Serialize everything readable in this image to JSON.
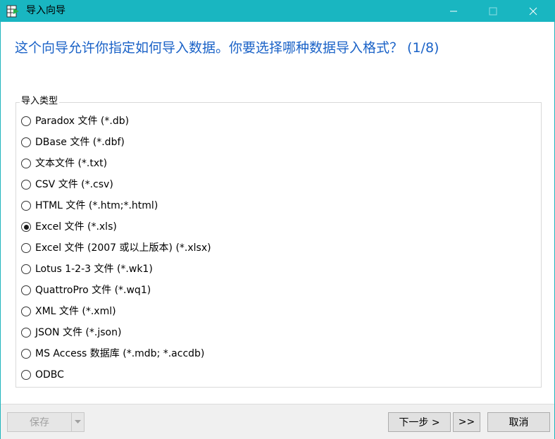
{
  "window": {
    "title": "导入向导",
    "accent_color": "#19b6c1",
    "icon": "import-table-icon"
  },
  "heading": "这个向导允许你指定如何导入数据。你要选择哪种数据导入格式？ (1/8)",
  "import_type": {
    "group_label": "导入类型",
    "selected": "Excel 文件 (*.xls)",
    "options": [
      "Paradox 文件 (*.db)",
      "DBase 文件 (*.dbf)",
      "文本文件 (*.txt)",
      "CSV 文件 (*.csv)",
      "HTML 文件 (*.htm;*.html)",
      "Excel 文件 (*.xls)",
      "Excel 文件 (2007 或以上版本) (*.xlsx)",
      "Lotus 1-2-3 文件 (*.wk1)",
      "QuattroPro 文件 (*.wq1)",
      "XML 文件 (*.xml)",
      "JSON 文件 (*.json)",
      "MS Access 数据库 (*.mdb; *.accdb)",
      "ODBC"
    ]
  },
  "footer": {
    "save_label": "保存",
    "next_label": "下一步 >",
    "last_label": ">>",
    "cancel_label": "取消"
  }
}
